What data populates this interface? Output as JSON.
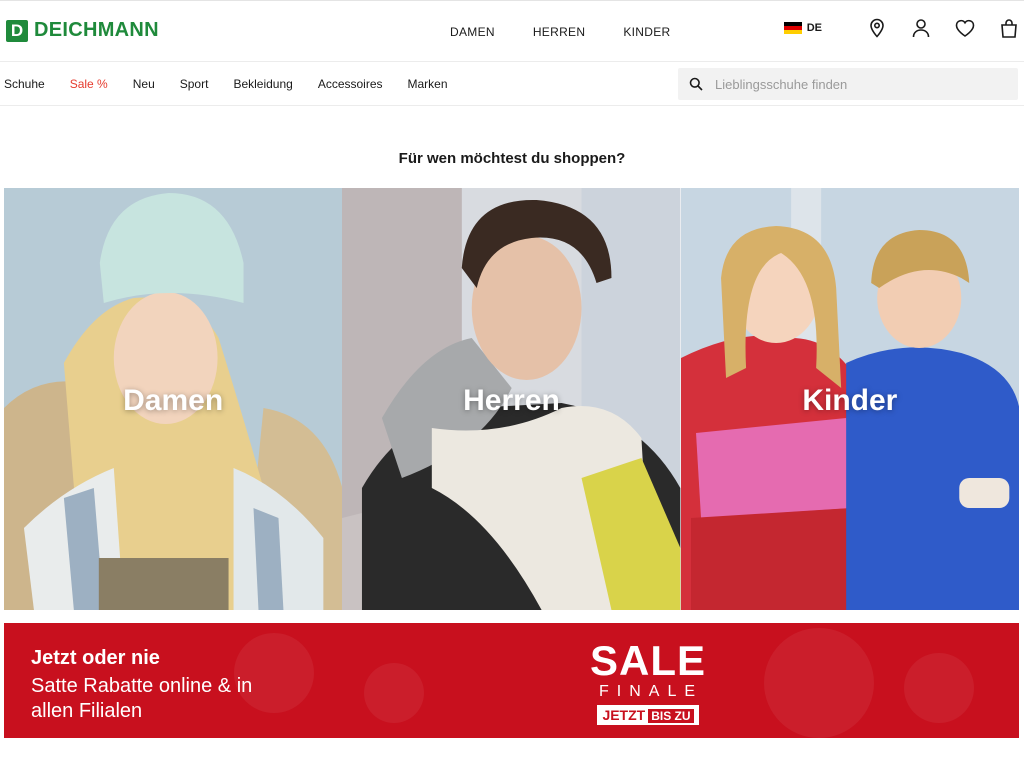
{
  "brand": {
    "logo_letter": "D",
    "name": "DEICHMANN",
    "color": "#1f8a3b"
  },
  "gender_nav": [
    "DAMEN",
    "HERREN",
    "KINDER"
  ],
  "language": {
    "code": "DE"
  },
  "header_icons": [
    "location-pin-icon",
    "user-icon",
    "heart-icon",
    "shopping-bag-icon"
  ],
  "categories": [
    {
      "label": "Schuhe"
    },
    {
      "label": "Sale %",
      "highlight": "#e63b2e"
    },
    {
      "label": "Neu"
    },
    {
      "label": "Sport"
    },
    {
      "label": "Bekleidung"
    },
    {
      "label": "Accessoires"
    },
    {
      "label": "Marken"
    }
  ],
  "search": {
    "placeholder": "Lieblingsschuhe finden"
  },
  "main": {
    "heading": "Für wen möchtest du shoppen?",
    "tiles": [
      {
        "label": "Damen"
      },
      {
        "label": "Herren"
      },
      {
        "label": "Kinder"
      }
    ]
  },
  "banner": {
    "line1": "Jetzt oder nie",
    "line2": "Satte Rabatte online & in allen Filialen",
    "sale": "SALE",
    "finale": "FINALE",
    "jetzt": "JETZT",
    "bis_zu": "BIS ZU",
    "color": "#c8101e"
  }
}
